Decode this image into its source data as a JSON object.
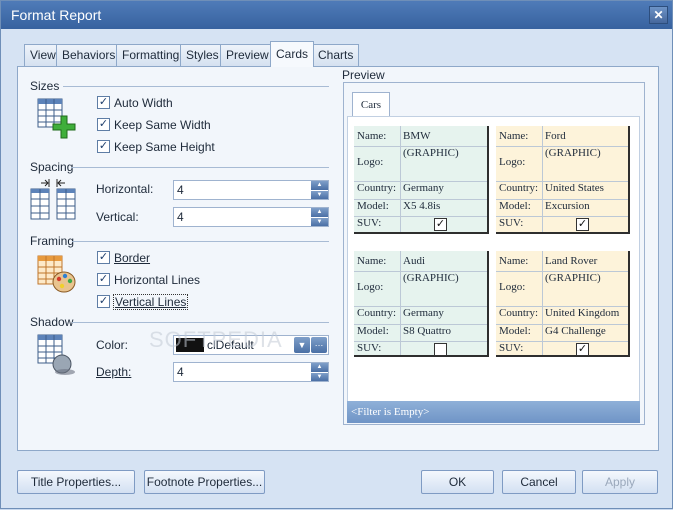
{
  "window": {
    "title": "Format Report"
  },
  "tabs": [
    "View",
    "Behaviors",
    "Formatting",
    "Styles",
    "Preview",
    "Cards",
    "Charts"
  ],
  "active_tab": "Cards",
  "sizes": {
    "title": "Sizes",
    "auto_width": {
      "label": "Auto Width",
      "checked": true
    },
    "keep_same_width": {
      "label": "Keep Same Width",
      "checked": true
    },
    "keep_same_height": {
      "label": "Keep Same Height",
      "checked": true
    }
  },
  "spacing": {
    "title": "Spacing",
    "horizontal": {
      "label": "Horizontal:",
      "value": "4"
    },
    "vertical": {
      "label": "Vertical:",
      "value": "4"
    }
  },
  "framing": {
    "title": "Framing",
    "border": {
      "label": "Border",
      "checked": true
    },
    "horizontal_lines": {
      "label": "Horizontal Lines",
      "checked": true
    },
    "vertical_lines": {
      "label": "Vertical Lines",
      "checked": true
    }
  },
  "shadow": {
    "title": "Shadow",
    "color": {
      "label": "Color:",
      "value": "clDefault"
    },
    "depth": {
      "label": "Depth:",
      "value": "4"
    }
  },
  "preview": {
    "title": "Preview",
    "tab": "Cars",
    "filter_text": "<Filter is Empty>",
    "field_labels": {
      "name": "Name:",
      "logo": "Logo:",
      "country": "Country:",
      "model": "Model:",
      "suv": "SUV:"
    },
    "cards": [
      {
        "name": "BMW",
        "logo": "(GRAPHIC)",
        "country": "Germany",
        "model": "X5 4.8is",
        "suv": true,
        "bg": "#e6f3ee"
      },
      {
        "name": "Ford",
        "logo": "(GRAPHIC)",
        "country": "United States",
        "model": "Excursion",
        "suv": true,
        "bg": "#fdf3da"
      },
      {
        "name": "Audi",
        "logo": "(GRAPHIC)",
        "country": "Germany",
        "model": "S8 Quattro",
        "suv": false,
        "bg": "#e6f3ee"
      },
      {
        "name": "Land Rover",
        "logo": "(GRAPHIC)",
        "country": "United Kingdom",
        "model": "G4 Challenge",
        "suv": true,
        "bg": "#fdf3da"
      }
    ]
  },
  "buttons": {
    "title_properties": "Title Properties...",
    "footnote_properties": "Footnote Properties...",
    "ok": "OK",
    "cancel": "Cancel",
    "apply": "Apply"
  },
  "colors": {
    "accent": "#37629f",
    "card_green": "#e6f3ee",
    "card_yellow": "#fdf3da"
  },
  "watermark": "SOFTPEDIA"
}
